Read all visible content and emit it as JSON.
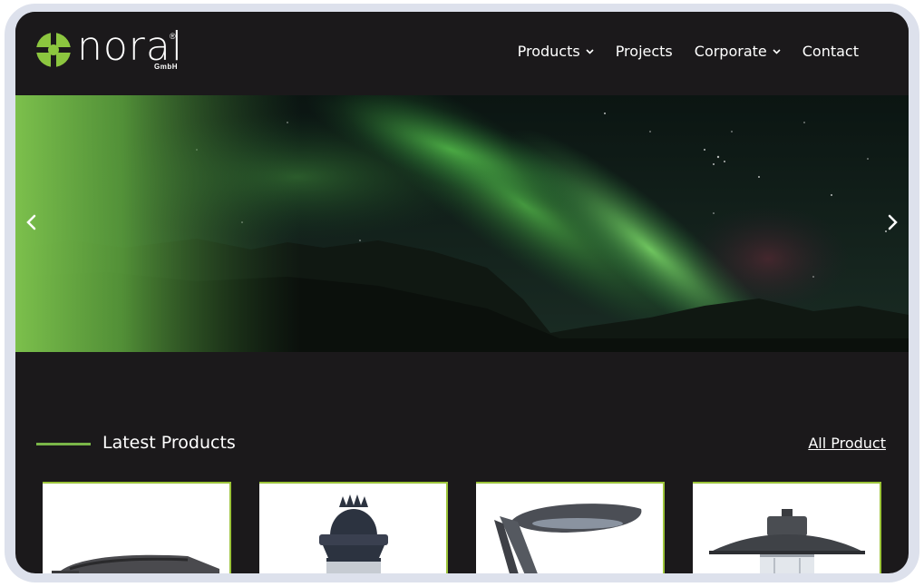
{
  "brand": {
    "name": "noral",
    "registered": "®",
    "suffix": "GmbH",
    "accent_color": "#8cc63f"
  },
  "nav": {
    "items": [
      {
        "label": "Products",
        "has_dropdown": true
      },
      {
        "label": "Projects",
        "has_dropdown": false
      },
      {
        "label": "Corporate",
        "has_dropdown": true
      },
      {
        "label": "Contact",
        "has_dropdown": false
      }
    ]
  },
  "hero": {
    "image": "aurora-over-mountains",
    "prev_icon": "chevron-left-icon",
    "next_icon": "chevron-right-icon"
  },
  "latest": {
    "title": "Latest Products",
    "all_link": "All Product",
    "cards": [
      {
        "image": "street-light-arm"
      },
      {
        "image": "decorative-lantern"
      },
      {
        "image": "pole-top-luminaire"
      },
      {
        "image": "dome-pendant-light"
      }
    ]
  },
  "colors": {
    "background": "#1b191b",
    "accent": "#7ab648",
    "card_border": "#9cc43a",
    "frame": "#dde1ec"
  }
}
